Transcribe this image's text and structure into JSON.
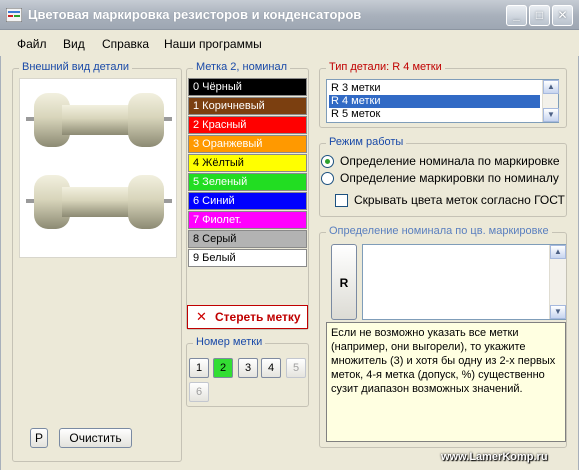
{
  "window": {
    "title": "Цветовая маркировка резисторов и конденсаторов",
    "min_glyph": "_",
    "max_glyph": "□",
    "close_glyph": "✕"
  },
  "menu": [
    "Файл",
    "Вид",
    "Справка",
    "Наши программы"
  ],
  "part_view": {
    "label": "Внешний вид детали",
    "p_button": "Р",
    "clear_button": "Очистить"
  },
  "band": {
    "label": "Метка 2, номинал",
    "colors": [
      {
        "label": "0 Чёрный",
        "bg": "#000000",
        "fg": "#ffffff"
      },
      {
        "label": "1 Коричневый",
        "bg": "#7b3f10",
        "fg": "#ffffff"
      },
      {
        "label": "2 Красный",
        "bg": "#ff0000",
        "fg": "#ffffff"
      },
      {
        "label": "3 Оранжевый",
        "bg": "#ff9900",
        "fg": "#ffffff"
      },
      {
        "label": "4 Жёлтый",
        "bg": "#ffff00",
        "fg": "#000000"
      },
      {
        "label": "5 Зеленый",
        "bg": "#22dd22",
        "fg": "#ffffff"
      },
      {
        "label": "6 Синий",
        "bg": "#0000ff",
        "fg": "#ffffff"
      },
      {
        "label": "7 Фиолет.",
        "bg": "#ff00ff",
        "fg": "#ffffff"
      },
      {
        "label": "8 Серый",
        "bg": "#b3b3b3",
        "fg": "#000000"
      },
      {
        "label": "9 Белый",
        "bg": "#ffffff",
        "fg": "#000000"
      }
    ],
    "erase_button": "Стереть метку",
    "erase_icon": "close-icon"
  },
  "band_number": {
    "label": "Номер метки",
    "buttons": [
      {
        "label": "1",
        "state": "normal"
      },
      {
        "label": "2",
        "state": "active"
      },
      {
        "label": "3",
        "state": "normal"
      },
      {
        "label": "4",
        "state": "normal"
      },
      {
        "label": "5",
        "state": "disabled"
      },
      {
        "label": "6",
        "state": "disabled"
      }
    ]
  },
  "part_type": {
    "label": "Тип детали: R 4 метки",
    "options": [
      "R 3 метки",
      "R 4 метки",
      "R 5 меток"
    ],
    "selected": "R 4 метки"
  },
  "mode": {
    "label": "Режим работы",
    "option_1": "Определение номинала по маркировке",
    "option_2": "Определение маркировки по номиналу",
    "selected": "Определение номинала по маркировке",
    "hide_gost": "Скрывать цвета меток согласно ГОСТ",
    "hide_gost_checked": false
  },
  "nominal": {
    "label": "Определение номинала по цв. маркировке",
    "r_button": "R",
    "result": "",
    "info": "Если не возможно указать все метки (например, они выгорели), то укажите множитель (3) и хотя бы одну из 2-х первых меток, 4-я метка (допуск, %) существенно сузит диапазон возможных значений."
  },
  "watermark": "www.LamerKomp.ru"
}
